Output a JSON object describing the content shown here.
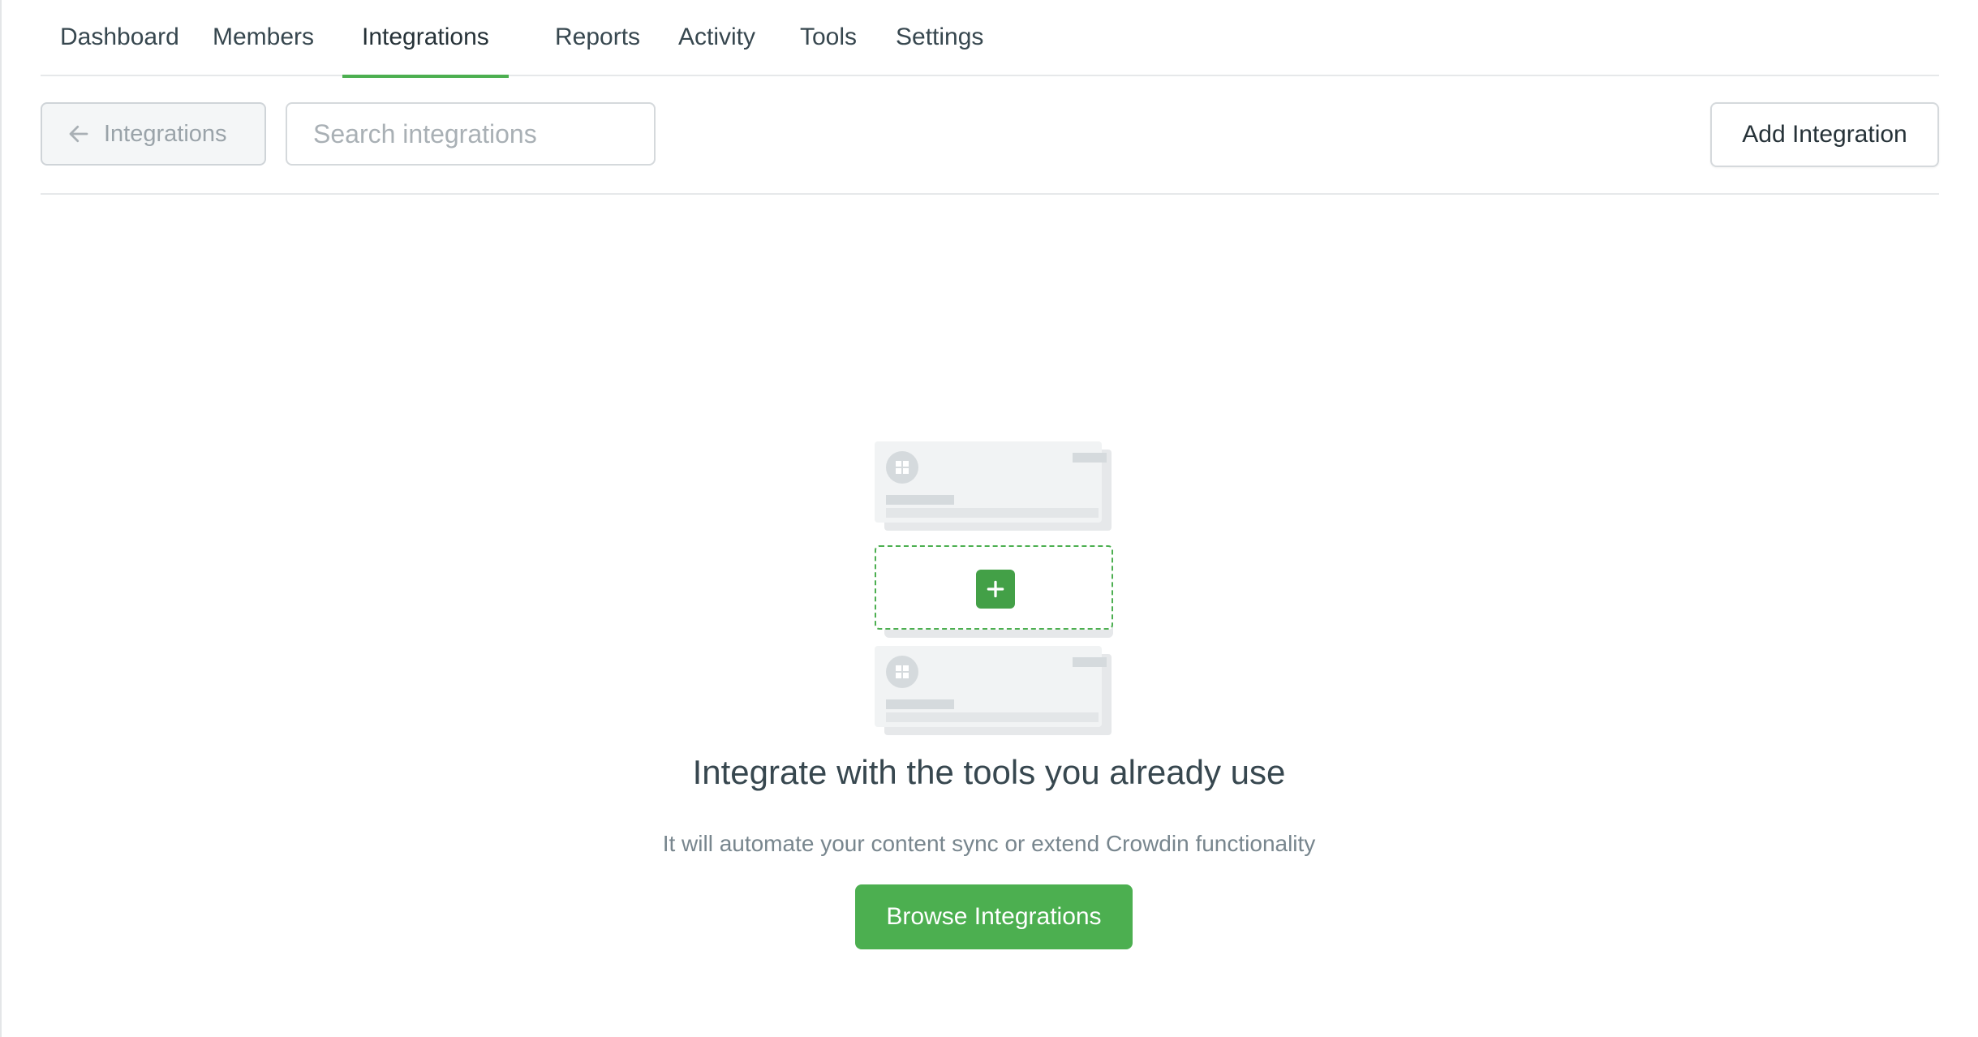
{
  "tabs": [
    {
      "label": "Dashboard"
    },
    {
      "label": "Members"
    },
    {
      "label": "Integrations"
    },
    {
      "label": "Reports"
    },
    {
      "label": "Activity"
    },
    {
      "label": "Tools"
    },
    {
      "label": "Settings"
    }
  ],
  "toolbar": {
    "back_label": "Integrations",
    "search_placeholder": "Search integrations",
    "search_value": "",
    "add_label": "Add Integration"
  },
  "empty_state": {
    "title": "Integrate with the tools you already use",
    "subtitle": "It will automate your content sync or extend Crowdin functionality",
    "cta_label": "Browse Integrations"
  },
  "colors": {
    "accent": "#4caf50",
    "text": "#263238",
    "muted": "#78868e"
  },
  "icons": {
    "back": "arrow-left-icon",
    "plus": "plus-icon",
    "card_logo": "grid-icon"
  }
}
